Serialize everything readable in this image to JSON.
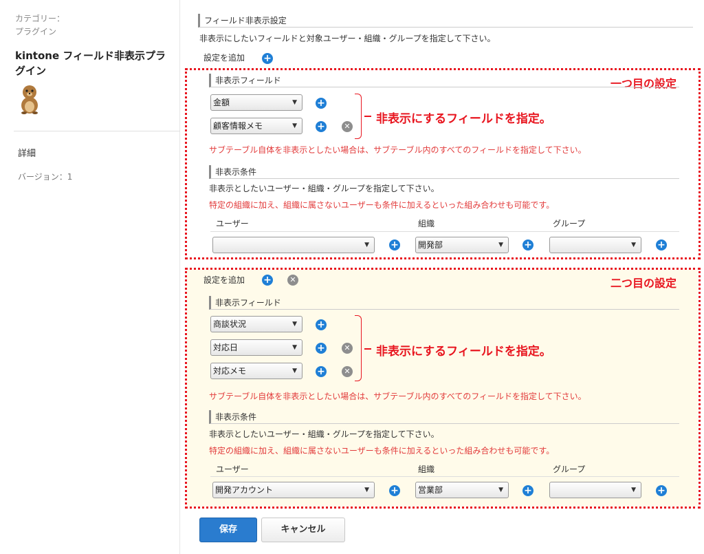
{
  "sidebar": {
    "category_label": "カテゴリー：",
    "category_value": "プラグイン",
    "plugin_title": "kintone フィールド非表示プラグイン",
    "detail_link": "詳細",
    "version": "バージョン：1"
  },
  "main": {
    "section_title": "フィールド非表示設定",
    "description": "非表示にしたいフィールドと対象ユーザー・組織・グループを指定して下さい。",
    "add_setting": "設定を追加"
  },
  "settings": [
    {
      "box_label": "一つ目の設定",
      "fields_header": "非表示フィールド",
      "fields": [
        "金額",
        "顧客情報メモ"
      ],
      "fields_annotation": "非表示にするフィールドを指定。",
      "subtable_note": "サブテーブル自体を非表示としたい場合は、サブテーブル内のすべてのフィールドを指定して下さい。",
      "conditions_header": "非表示条件",
      "conditions_desc": "非表示としたいユーザー・組織・グループを指定して下さい。",
      "conditions_note": "特定の組織に加え、組織に属さないユーザーも条件に加えるといった組み合わせも可能です。",
      "user_header": "ユーザー",
      "org_header": "組織",
      "group_header": "グループ",
      "user_value": "",
      "org_value": "開発部",
      "group_value": ""
    },
    {
      "box_label": "二つ目の設定",
      "add_setting": "設定を追加",
      "fields_header": "非表示フィールド",
      "fields": [
        "商談状況",
        "対応日",
        "対応メモ"
      ],
      "fields_annotation": "非表示にするフィールドを指定。",
      "subtable_note": "サブテーブル自体を非表示としたい場合は、サブテーブル内のすべてのフィールドを指定して下さい。",
      "conditions_header": "非表示条件",
      "conditions_desc": "非表示としたいユーザー・組織・グループを指定して下さい。",
      "conditions_note": "特定の組織に加え、組織に属さないユーザーも条件に加えるといった組み合わせも可能です。",
      "user_header": "ユーザー",
      "org_header": "組織",
      "group_header": "グループ",
      "user_value": "開発アカウント",
      "org_value": "営業部",
      "group_value": ""
    }
  ],
  "buttons": {
    "save": "保存",
    "cancel": "キャンセル"
  },
  "icons": {
    "add": "plus-circle-icon",
    "remove": "x-circle-icon",
    "dropdown": "triangle-down-icon"
  },
  "colors": {
    "accent_blue": "#1f7fd6",
    "annotation_red": "#e8151f",
    "note_red": "#e23b3b",
    "second_setting_bg": "#fffbea"
  }
}
